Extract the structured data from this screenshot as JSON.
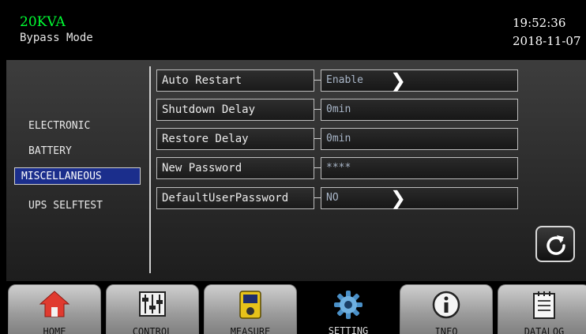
{
  "header": {
    "model": "20KVA",
    "mode": "Bypass Mode",
    "time": "19:52:36",
    "date": "2018-11-07"
  },
  "categories": [
    {
      "label": "ELECTRONIC",
      "active": false
    },
    {
      "label": "BATTERY",
      "active": false
    },
    {
      "label": "MISCELLANEOUS",
      "active": true
    },
    {
      "label": "UPS SELFTEST",
      "active": false
    }
  ],
  "settings": [
    {
      "label": "Auto Restart",
      "value": "Enable",
      "has_arrow": true
    },
    {
      "label": "Shutdown Delay",
      "value": "0min",
      "has_arrow": false
    },
    {
      "label": "Restore Delay",
      "value": "0min",
      "has_arrow": false
    },
    {
      "label": "New Password",
      "value": "****",
      "has_arrow": false
    },
    {
      "label": "DefaultUserPassword",
      "value": "NO",
      "has_arrow": true
    }
  ],
  "refresh": {
    "icon": "refresh-icon"
  },
  "nav": {
    "tabs": [
      {
        "label": "HOME",
        "icon": "home-icon",
        "active": false
      },
      {
        "label": "CONTROL",
        "icon": "control-icon",
        "active": false
      },
      {
        "label": "MEASURE",
        "icon": "measure-icon",
        "active": false
      },
      {
        "label": "SETTING",
        "icon": "setting-icon",
        "active": true
      },
      {
        "label": "INFO",
        "icon": "info-icon",
        "active": false
      },
      {
        "label": "DATALOG",
        "icon": "datalog-icon",
        "active": false
      }
    ]
  },
  "colors": {
    "model_green": "#00ff33",
    "active_blue": "#1b2e8c",
    "value_text": "#a9b6c8"
  }
}
